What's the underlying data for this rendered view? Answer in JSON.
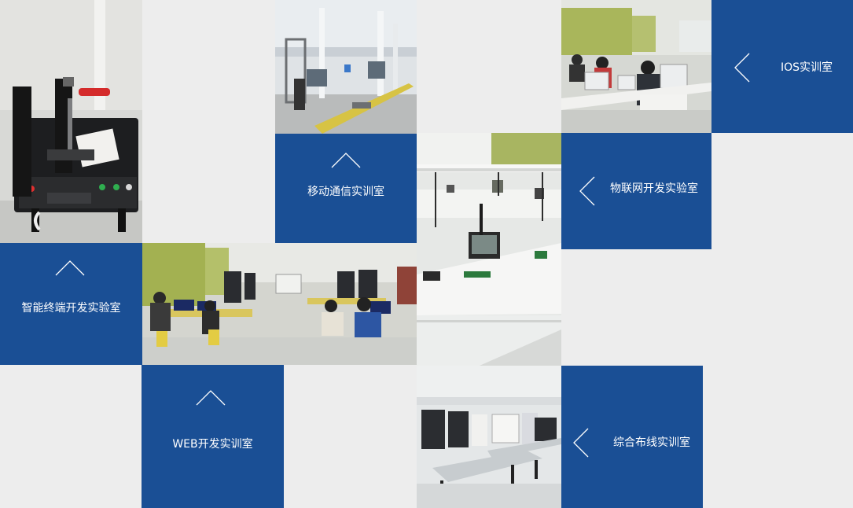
{
  "labs": {
    "ios": {
      "title": "IOS实训室",
      "arrow": "chevron-left-icon"
    },
    "iot": {
      "title": "物联网开发实验室",
      "arrow": "chevron-left-icon"
    },
    "mobile": {
      "title": "移动通信实训室",
      "arrow": "chevron-up-icon"
    },
    "smart": {
      "title": "智能终端开发实验室",
      "arrow": "chevron-up-icon"
    },
    "web": {
      "title": "WEB开发实训室",
      "arrow": "chevron-up-icon"
    },
    "wiring": {
      "title": "综合布线实训室",
      "arrow": "chevron-left-icon"
    }
  },
  "colors": {
    "tile_blue": "#1a4f95",
    "page_bg": "#ededed",
    "label_text": "#ffffff"
  }
}
